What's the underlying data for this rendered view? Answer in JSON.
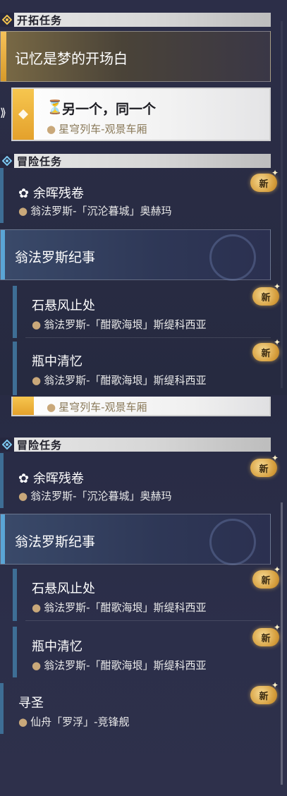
{
  "top": {
    "trailblaze_header": "开拓任务",
    "mission_gold": "记忆是梦的开场白",
    "selected": {
      "hourglass": "⏳",
      "title": "另一个，同一个",
      "location": "星穹列车-观景车厢"
    },
    "adventure_header": "冒险任务",
    "adventure_first": {
      "title": "余晖残卷",
      "location": "翁法罗斯-「沉沦暮城」奥赫玛",
      "badge": "新"
    },
    "series_title": "翁法罗斯纪事",
    "sub_items": [
      {
        "title": "石悬风止处",
        "location": "翁法罗斯-「酣歌海垠」斯缇科西亚",
        "badge": "新"
      },
      {
        "title": "瓶中清忆",
        "location": "翁法罗斯-「酣歌海垠」斯缇科西亚",
        "badge": "新"
      }
    ]
  },
  "bottom": {
    "clipped_location": "星穹列车-观景车厢",
    "adventure_header": "冒险任务",
    "adventure_first": {
      "title": "余晖残卷",
      "location": "翁法罗斯-「沉沦暮城」奥赫玛",
      "badge": "新"
    },
    "series_title": "翁法罗斯纪事",
    "sub_items": [
      {
        "title": "石悬风止处",
        "location": "翁法罗斯-「酣歌海垠」斯缇科西亚",
        "badge": "新"
      },
      {
        "title": "瓶中清忆",
        "location": "翁法罗斯-「酣歌海垠」斯缇科西亚",
        "badge": "新"
      }
    ],
    "last_entry": {
      "title": "寻圣",
      "location": "仙舟「罗浮」-竞锋舰",
      "badge": "新"
    }
  },
  "colors": {
    "gold": "#e4a12c",
    "accent_blue": "#5aa5d6",
    "header_bg": "#d7d7d7"
  },
  "icons": {
    "section": "diamond-icon",
    "pin": "map-pin-icon",
    "mission_type": "mission-type-icon",
    "new_badge": "new-badge-icon"
  }
}
